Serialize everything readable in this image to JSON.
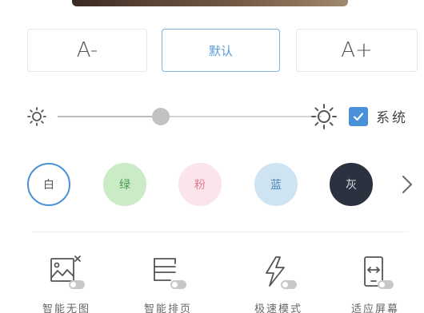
{
  "font_size": {
    "decrease_label": "A-",
    "default_label": "默认",
    "increase_label": "A+"
  },
  "brightness": {
    "level": 0.39,
    "system_checked": true,
    "system_label": "系统"
  },
  "background_colors": [
    {
      "label": "白",
      "bg": "#ffffff",
      "fg": "#555555",
      "border": "#4a90d9",
      "selected": true
    },
    {
      "label": "绿",
      "bg": "#cbeac6",
      "fg": "#4a9a52"
    },
    {
      "label": "粉",
      "bg": "#fbe4ea",
      "fg": "#e07a98"
    },
    {
      "label": "蓝",
      "bg": "#cfe4f2",
      "fg": "#4b88b5"
    },
    {
      "label": "灰",
      "bg": "#2c3140",
      "fg": "#d8dbe2"
    }
  ],
  "tools": [
    {
      "label": "智能无图",
      "icon": "no-image-icon"
    },
    {
      "label": "智能排页",
      "icon": "smart-layout-icon"
    },
    {
      "label": "极速模式",
      "icon": "speed-mode-icon"
    },
    {
      "label": "适应屏幕",
      "icon": "fit-screen-icon"
    }
  ],
  "colors": {
    "accent": "#4a90d9",
    "icon": "#555555",
    "toggle": "#c8c8c8"
  }
}
